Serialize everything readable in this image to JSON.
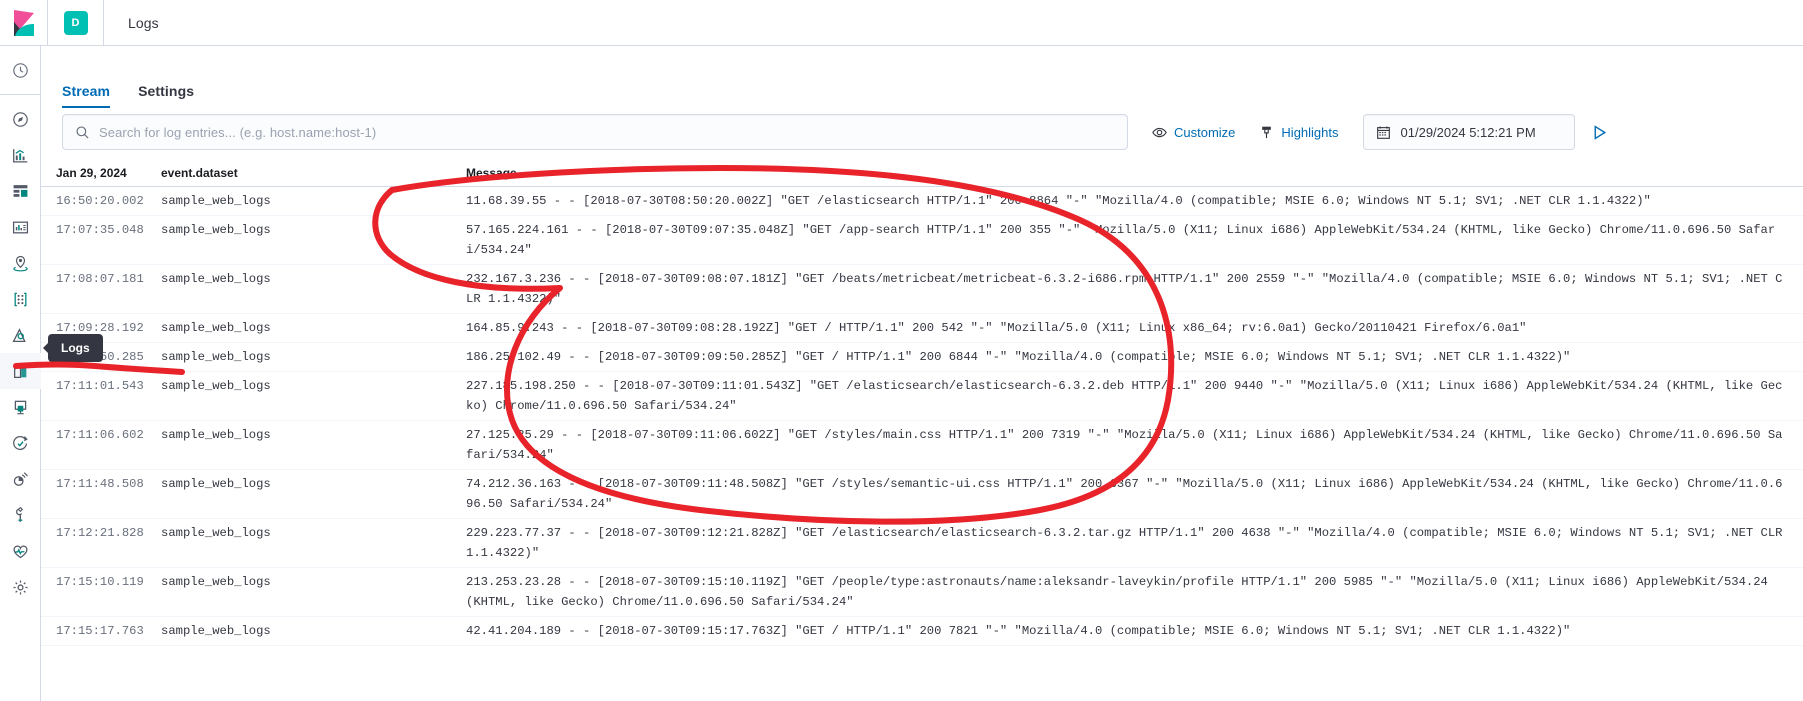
{
  "topbar": {
    "logo_icon": "kibana-logo",
    "space_initial": "D",
    "app_title": "Logs"
  },
  "sidebar": {
    "tooltip_label": "Logs",
    "items": [
      {
        "icon": "recently-viewed-clock-icon",
        "selected": false
      },
      {
        "icon": "discover-compass-icon",
        "selected": false
      },
      {
        "icon": "visualize-chart-icon",
        "selected": false
      },
      {
        "icon": "dashboard-icon",
        "selected": false
      },
      {
        "icon": "canvas-icon",
        "selected": false
      },
      {
        "icon": "maps-marker-icon",
        "selected": false
      },
      {
        "icon": "machine-learning-icon",
        "selected": false
      },
      {
        "icon": "infrastructure-icon",
        "selected": false
      },
      {
        "icon": "logs-icon",
        "selected": true
      },
      {
        "icon": "apm-icon",
        "selected": false
      },
      {
        "icon": "uptime-icon",
        "selected": false
      },
      {
        "icon": "siem-icon",
        "selected": false
      },
      {
        "icon": "dev-tools-wrench-icon",
        "selected": false
      },
      {
        "icon": "monitoring-heartbeat-icon",
        "selected": false
      },
      {
        "icon": "management-gear-icon",
        "selected": false
      }
    ]
  },
  "tabs": [
    {
      "label": "Stream",
      "active": true
    },
    {
      "label": "Settings",
      "active": false
    }
  ],
  "toolbar": {
    "search_placeholder": "Search for log entries... (e.g. host.name:host-1)",
    "search_value": "",
    "search_icon": "search-icon",
    "customize_label": "Customize",
    "customize_icon": "eye-icon",
    "highlights_label": "Highlights",
    "highlights_icon": "brush-icon",
    "date_icon": "calendar-icon",
    "date_value": "01/29/2024 5:12:21 PM",
    "play_icon": "play-triangle-icon",
    "accent_color": "#006BB4"
  },
  "log_table": {
    "columns": {
      "time": "Jan 29, 2024",
      "dataset": "event.dataset",
      "message": "Message"
    },
    "rows": [
      {
        "time": "16:50:20.002",
        "dataset": "sample_web_logs",
        "message": "11.68.39.55 - - [2018-07-30T08:50:20.002Z] \"GET /elasticsearch HTTP/1.1\" 200 8864 \"-\" \"Mozilla/4.0 (compatible; MSIE 6.0; Windows NT 5.1; SV1; .NET CLR 1.1.4322)\""
      },
      {
        "time": "17:07:35.048",
        "dataset": "sample_web_logs",
        "message": "57.165.224.161 - - [2018-07-30T09:07:35.048Z] \"GET /app-search HTTP/1.1\" 200 355 \"-\" \"Mozilla/5.0 (X11; Linux i686) AppleWebKit/534.24 (KHTML, like Gecko) Chrome/11.0.696.50 Safari/534.24\""
      },
      {
        "time": "17:08:07.181",
        "dataset": "sample_web_logs",
        "message": "232.167.3.236 - - [2018-07-30T09:08:07.181Z] \"GET /beats/metricbeat/metricbeat-6.3.2-i686.rpm HTTP/1.1\" 200 2559 \"-\" \"Mozilla/4.0 (compatible; MSIE 6.0; Windows NT 5.1; SV1; .NET CLR 1.1.4322)\""
      },
      {
        "time": "17:09:28.192",
        "dataset": "sample_web_logs",
        "message": "164.85.9.243 - - [2018-07-30T09:08:28.192Z] \"GET / HTTP/1.1\" 200 542 \"-\" \"Mozilla/5.0 (X11; Linux x86_64; rv:6.0a1) Gecko/20110421 Firefox/6.0a1\""
      },
      {
        "time": "17:09:50.285",
        "dataset": "sample_web_logs",
        "message": "186.25.102.49 - - [2018-07-30T09:09:50.285Z] \"GET / HTTP/1.1\" 200 6844 \"-\" \"Mozilla/4.0 (compatible; MSIE 6.0; Windows NT 5.1; SV1; .NET CLR 1.1.4322)\""
      },
      {
        "time": "17:11:01.543",
        "dataset": "sample_web_logs",
        "message": "227.185.198.250 - - [2018-07-30T09:11:01.543Z] \"GET /elasticsearch/elasticsearch-6.3.2.deb HTTP/1.1\" 200 9440 \"-\" \"Mozilla/5.0 (X11; Linux i686) AppleWebKit/534.24 (KHTML, like Gecko) Chrome/11.0.696.50 Safari/534.24\""
      },
      {
        "time": "17:11:06.602",
        "dataset": "sample_web_logs",
        "message": "27.125.25.29 - - [2018-07-30T09:11:06.602Z] \"GET /styles/main.css HTTP/1.1\" 200 7319 \"-\" \"Mozilla/5.0 (X11; Linux i686) AppleWebKit/534.24 (KHTML, like Gecko) Chrome/11.0.696.50 Safari/534.24\""
      },
      {
        "time": "17:11:48.508",
        "dataset": "sample_web_logs",
        "message": "74.212.36.163 - - [2018-07-30T09:11:48.508Z] \"GET /styles/semantic-ui.css HTTP/1.1\" 200 6367 \"-\" \"Mozilla/5.0 (X11; Linux i686) AppleWebKit/534.24 (KHTML, like Gecko) Chrome/11.0.696.50 Safari/534.24\""
      },
      {
        "time": "17:12:21.828",
        "dataset": "sample_web_logs",
        "message": "229.223.77.37 - - [2018-07-30T09:12:21.828Z] \"GET /elasticsearch/elasticsearch-6.3.2.tar.gz HTTP/1.1\" 200 4638 \"-\" \"Mozilla/4.0 (compatible; MSIE 6.0; Windows NT 5.1; SV1; .NET CLR 1.1.4322)\""
      },
      {
        "time": "17:15:10.119",
        "dataset": "sample_web_logs",
        "message": "213.253.23.28 - - [2018-07-30T09:15:10.119Z] \"GET /people/type:astronauts/name:aleksandr-laveykin/profile HTTP/1.1\" 200 5985 \"-\" \"Mozilla/5.0 (X11; Linux i686) AppleWebKit/534.24 (KHTML, like Gecko) Chrome/11.0.696.50 Safari/534.24\""
      },
      {
        "time": "17:15:17.763",
        "dataset": "sample_web_logs",
        "message": "42.41.204.189 - - [2018-07-30T09:15:17.763Z] \"GET / HTTP/1.1\" 200 7821 \"-\" \"Mozilla/4.0 (compatible; MSIE 6.0; Windows NT 5.1; SV1; .NET CLR 1.1.4322)\""
      }
    ]
  },
  "annotation": {
    "shape": "hand-drawn-red-circle",
    "color": "#e8232a",
    "stroke_width": 6
  }
}
